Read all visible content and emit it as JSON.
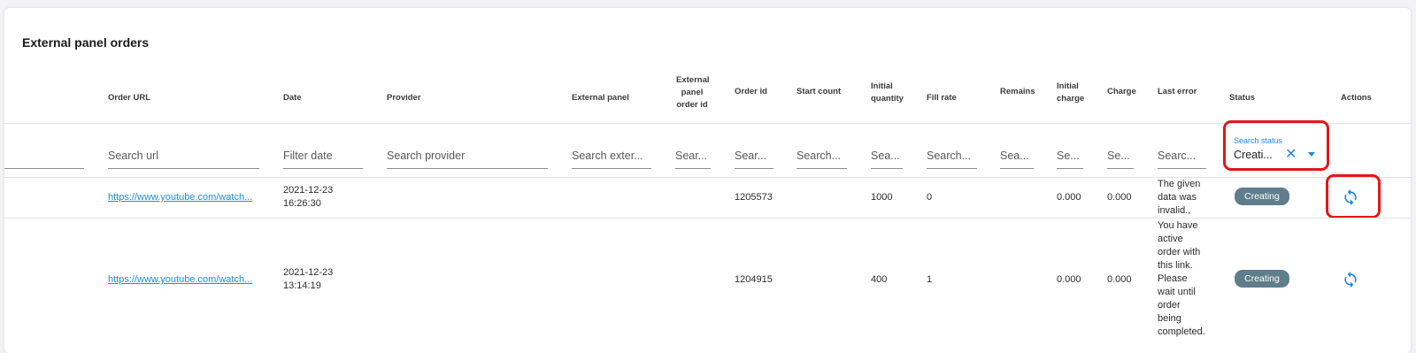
{
  "page": {
    "title": "External panel orders"
  },
  "columns": {
    "order_url": "Order URL",
    "date": "Date",
    "provider": "Provider",
    "external_panel": "External panel",
    "external_panel_order_id": [
      "External",
      "panel",
      "order id"
    ],
    "order_id": "Order id",
    "start_count": "Start count",
    "initial_quantity": [
      "Initial",
      "quantity"
    ],
    "fill_rate": "Fill rate",
    "remains": "Remains",
    "initial_charge": [
      "Initial",
      "charge"
    ],
    "charge": "Charge",
    "last_error": "Last error",
    "status": "Status",
    "actions": "Actions"
  },
  "filters": {
    "url": "Search url",
    "date": "Filter date",
    "provider": "Search provider",
    "external_panel": "Search exter...",
    "external_panel_order_id": "Sear...",
    "order_id": "Sear...",
    "start_count": "Search...",
    "initial_quantity": "Sea...",
    "fill_rate": "Search...",
    "remains": "Sea...",
    "initial_charge": "Se...",
    "charge": "Se...",
    "last_error": "Searc...",
    "status": {
      "label": "Search status",
      "value": "Creati..."
    }
  },
  "rows": [
    {
      "order_url": "https://www.youtube.com/watch...",
      "date": "2021-12-23",
      "time": "16:26:30",
      "order_id": "1205573",
      "initial_quantity": "1000",
      "fill_rate": "0",
      "initial_charge": "0.000",
      "charge": "0.000",
      "last_error": [
        "The given",
        "data was",
        "invalid.,"
      ],
      "status": "Creating"
    },
    {
      "order_url": "https://www.youtube.com/watch...",
      "date": "2021-12-23",
      "time": "13:14:19",
      "order_id": "1204915",
      "initial_quantity": "400",
      "fill_rate": "1",
      "initial_charge": "0.000",
      "charge": "0.000",
      "last_error": [
        "You have",
        "active",
        "order with",
        "this link.",
        "Please",
        "wait until",
        "order",
        "being",
        "completed."
      ],
      "status": "Creating"
    }
  ],
  "icons": {
    "refresh": "refresh-icon",
    "clear": "close-icon",
    "dropdown": "caret-down-icon"
  },
  "colors": {
    "accent": "#1e88e5",
    "badge": "#607d8b",
    "highlight": "#e11818",
    "link": "#1d8fd9"
  }
}
